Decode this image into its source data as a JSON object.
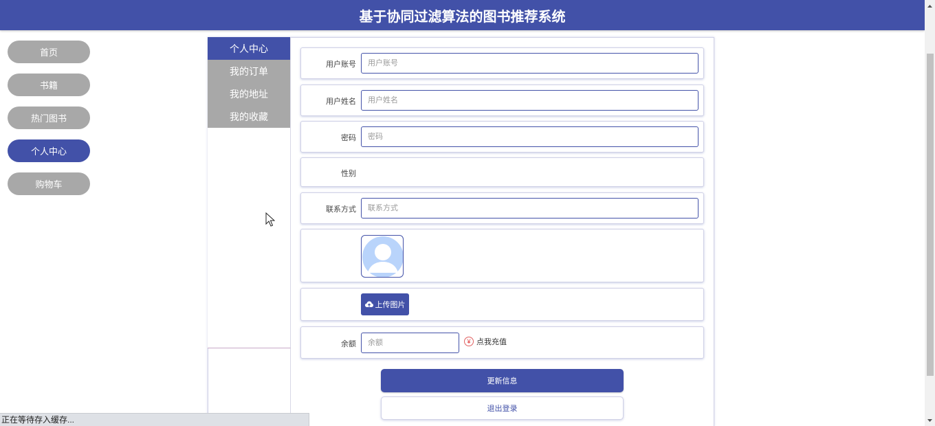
{
  "header": {
    "title": "基于协同过滤算法的图书推荐系统",
    "bg_color": "#4251a8"
  },
  "nav": {
    "items": [
      {
        "label": "首页",
        "active": false
      },
      {
        "label": "书籍",
        "active": false
      },
      {
        "label": "热门图书",
        "active": false
      },
      {
        "label": "个人中心",
        "active": true
      },
      {
        "label": "购物车",
        "active": false
      }
    ]
  },
  "submenu": {
    "items": [
      {
        "label": "个人中心",
        "active": true
      },
      {
        "label": "我的订单",
        "active": false
      },
      {
        "label": "我的地址",
        "active": false
      },
      {
        "label": "我的收藏",
        "active": false
      }
    ]
  },
  "form": {
    "account": {
      "label": "用户账号",
      "placeholder": "用户账号",
      "value": ""
    },
    "name": {
      "label": "用户姓名",
      "placeholder": "用户姓名",
      "value": ""
    },
    "password": {
      "label": "密码",
      "placeholder": "密码",
      "value": ""
    },
    "gender": {
      "label": "性别"
    },
    "contact": {
      "label": "联系方式",
      "placeholder": "联系方式",
      "value": ""
    },
    "avatar_icon": "default-user-avatar-icon",
    "upload": {
      "label": "上传图片",
      "icon": "cloud-upload-icon"
    },
    "balance": {
      "label": "余额",
      "placeholder": "余额",
      "value": "",
      "recharge_label": "点我充值",
      "recharge_icon": "¥"
    }
  },
  "actions": {
    "update_label": "更新信息",
    "logout_label": "退出登录"
  },
  "status_bar": {
    "text": "正在等待存入缓存..."
  }
}
